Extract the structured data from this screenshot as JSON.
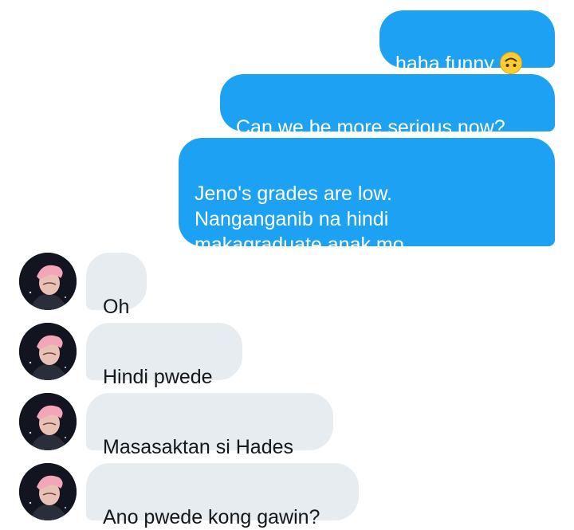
{
  "messages": {
    "sent": [
      {
        "text": "haha funny",
        "emoji": "upside-down-face-icon"
      },
      {
        "text": "Can we be more serious now?"
      },
      {
        "text": "Jeno's grades are low.\nNanganganib na hindi\nmakagraduate anak mo."
      }
    ],
    "received": [
      {
        "text": "Oh"
      },
      {
        "text": "Hindi pwede"
      },
      {
        "text": "Masasaktan si Hades"
      },
      {
        "text": "Ano pwede kong gawin?"
      }
    ]
  },
  "colors": {
    "sent_bubble": "#1da1f2",
    "received_bubble": "#e6ecf0",
    "received_text": "#14171a",
    "emoji": "#ffcc33"
  }
}
